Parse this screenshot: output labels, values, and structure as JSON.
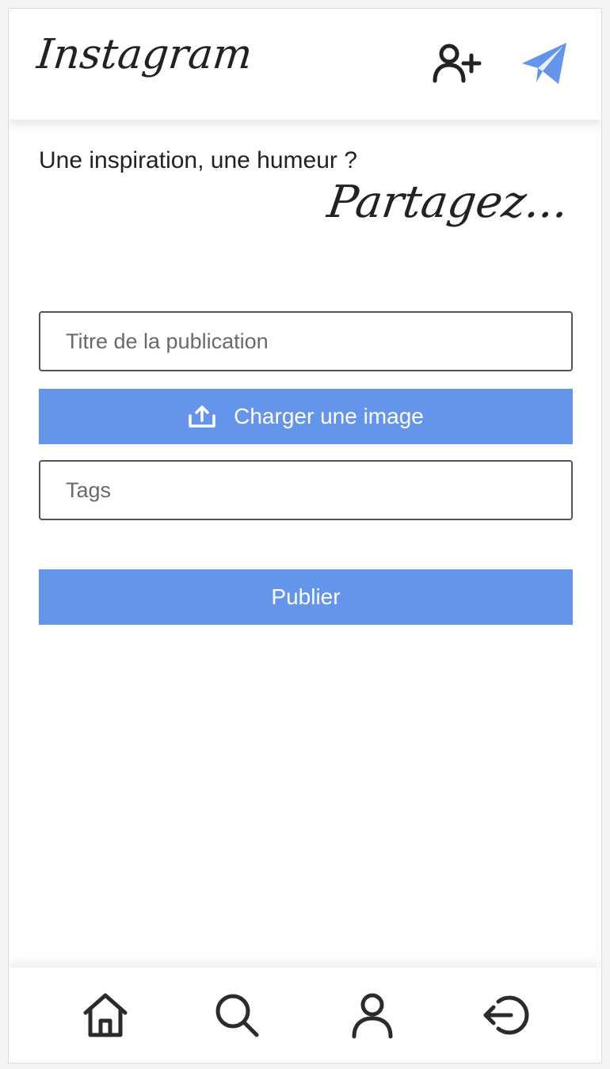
{
  "header": {
    "logo": "Instagram",
    "icons": [
      "user-plus-icon",
      "send-icon"
    ],
    "accent_color": "#6495ea"
  },
  "intro": {
    "question": "Une inspiration, une humeur ?",
    "script": "Partagez..."
  },
  "form": {
    "title_placeholder": "Titre de la publication",
    "title_value": "",
    "upload_label": "Charger une image",
    "tags_placeholder": "Tags",
    "tags_value": "",
    "publish_label": "Publier"
  },
  "bottom_nav": {
    "items": [
      "home-icon",
      "search-icon",
      "profile-icon",
      "logout-icon"
    ]
  }
}
